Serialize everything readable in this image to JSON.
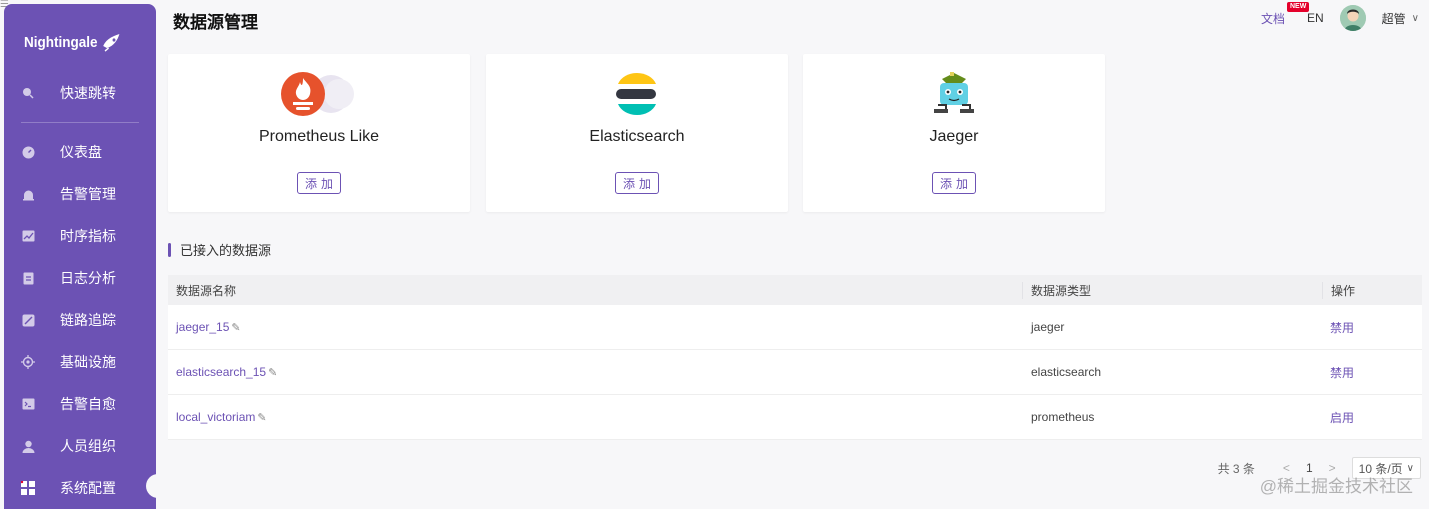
{
  "app": {
    "logo_text": "Nightingale"
  },
  "sidebar": {
    "items": [
      {
        "label": "快速跳转",
        "icon": "search-icon"
      },
      {
        "label": "仪表盘",
        "icon": "dashboard-icon"
      },
      {
        "label": "告警管理",
        "icon": "alarm-icon"
      },
      {
        "label": "时序指标",
        "icon": "chart-icon"
      },
      {
        "label": "日志分析",
        "icon": "log-icon"
      },
      {
        "label": "链路追踪",
        "icon": "trace-icon"
      },
      {
        "label": "基础设施",
        "icon": "infra-icon"
      },
      {
        "label": "告警自愈",
        "icon": "terminal-icon"
      },
      {
        "label": "人员组织",
        "icon": "user-icon"
      },
      {
        "label": "系统配置",
        "icon": "settings-grid-icon"
      }
    ]
  },
  "header": {
    "title": "数据源管理",
    "doc_label": "文档",
    "new_badge": "NEW",
    "lang": "EN",
    "username": "超管"
  },
  "datasource_types": [
    {
      "name": "Prometheus Like",
      "add_label": "添加",
      "icon": "prometheus-logo"
    },
    {
      "name": "Elasticsearch",
      "add_label": "添加",
      "icon": "elasticsearch-logo"
    },
    {
      "name": "Jaeger",
      "add_label": "添加",
      "icon": "jaeger-logo"
    }
  ],
  "connected": {
    "title": "已接入的数据源",
    "columns": [
      "数据源名称",
      "数据源类型",
      "操作"
    ],
    "rows": [
      {
        "name": "jaeger_15",
        "type": "jaeger",
        "action": "禁用"
      },
      {
        "name": "elasticsearch_15",
        "type": "elasticsearch",
        "action": "禁用"
      },
      {
        "name": "local_victoriam",
        "type": "prometheus",
        "action": "启用"
      }
    ]
  },
  "pagination": {
    "total": "共 3 条",
    "prev": "<",
    "page": "1",
    "next": ">",
    "page_size": "10 条/页"
  },
  "watermark": "@稀土掘金技术社区",
  "colors": {
    "accent": "#6c52b4",
    "badge": "#e4002b"
  }
}
